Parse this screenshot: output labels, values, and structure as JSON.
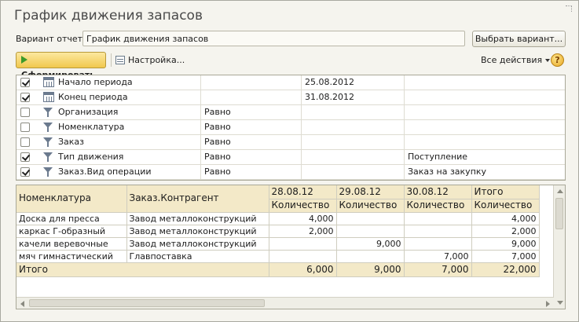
{
  "window": {
    "title": "График движения запасов"
  },
  "variant": {
    "label": "Вариант отчета:",
    "value": "График движения запасов",
    "choose_button": "Выбрать вариант..."
  },
  "toolbar": {
    "run_button": "Сформировать",
    "settings_button": "Настройка...",
    "all_actions": "Все действия",
    "help_label": "?"
  },
  "params": [
    {
      "checked": true,
      "icon": "calendar-icon",
      "name": "Начало периода",
      "condition": "",
      "value": "25.08.2012",
      "value2": ""
    },
    {
      "checked": true,
      "icon": "calendar-icon",
      "name": "Конец периода",
      "condition": "",
      "value": "31.08.2012",
      "value2": ""
    },
    {
      "checked": false,
      "icon": "filter-icon",
      "name": "Организация",
      "condition": "Равно",
      "value": "",
      "value2": ""
    },
    {
      "checked": false,
      "icon": "filter-icon",
      "name": "Номенклатура",
      "condition": "Равно",
      "value": "",
      "value2": ""
    },
    {
      "checked": false,
      "icon": "filter-icon",
      "name": "Заказ",
      "condition": "Равно",
      "value": "",
      "value2": ""
    },
    {
      "checked": true,
      "icon": "filter-icon",
      "name": "Тип движения",
      "condition": "Равно",
      "value": "",
      "value2": "Поступление"
    },
    {
      "checked": true,
      "icon": "filter-icon",
      "name": "Заказ.Вид операции",
      "condition": "Равно",
      "value": "",
      "value2": "Заказ на закупку"
    }
  ],
  "report": {
    "headers": {
      "item": "Номенклатура",
      "contractor": "Заказ.Контрагент",
      "dates": [
        "28.08.12",
        "29.08.12",
        "30.08.12"
      ],
      "total": "Итого",
      "measure": "Количество"
    },
    "rows": [
      {
        "item": "Доска для пресса",
        "contractor": "Завод металлоконструкций",
        "d1": "4,000",
        "d2": "",
        "d3": "",
        "total": "4,000"
      },
      {
        "item": "каркас Г-образный",
        "contractor": "Завод металлоконструкций",
        "d1": "2,000",
        "d2": "",
        "d3": "",
        "total": "2,000"
      },
      {
        "item": "качели веревочные",
        "contractor": "Завод металлоконструкций",
        "d1": "",
        "d2": "9,000",
        "d3": "",
        "total": "9,000"
      },
      {
        "item": "мяч гимнастический",
        "contractor": "Главпоставка",
        "d1": "",
        "d2": "",
        "d3": "7,000",
        "total": "7,000"
      }
    ],
    "totals": {
      "label": "Итого",
      "d1": "6,000",
      "d2": "9,000",
      "d3": "7,000",
      "total": "22,000"
    }
  }
}
